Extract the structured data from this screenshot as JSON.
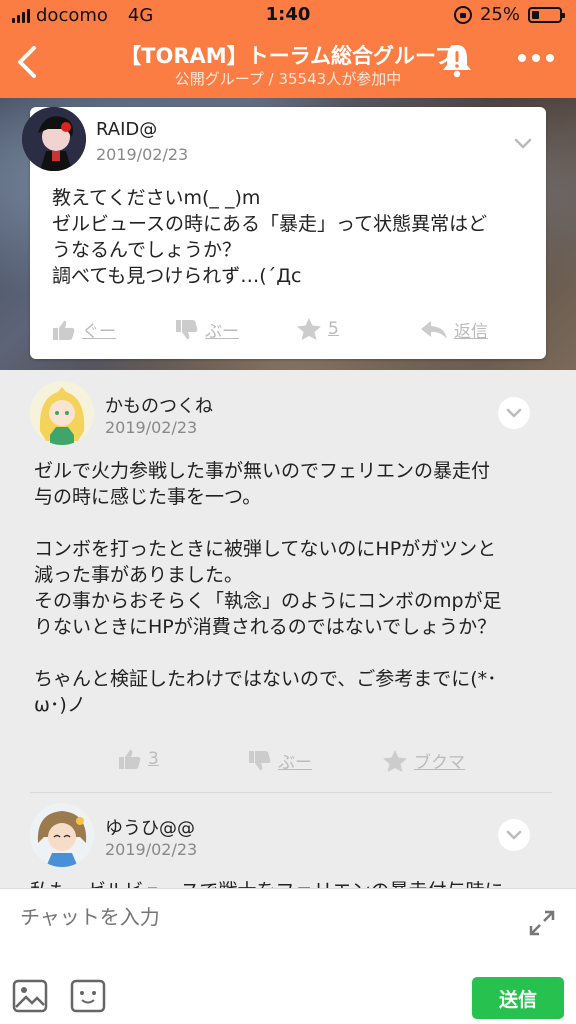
{
  "status": {
    "carrier": "docomo",
    "network": "4G",
    "time": "1:40",
    "battery": "25%",
    "battery_level": 0.25
  },
  "header": {
    "title": "【TORAM】トーラム総合グループ",
    "subtitle": "公開グループ / 35543人が参加中"
  },
  "post": {
    "username": "RAID@",
    "date": "2019/02/23",
    "lines": [
      "教えてくださいm(_ _)m",
      "ゼルビュースの時にある「暴走」って状態異常はど",
      "うなるんでしょうか？",
      "調べても見つけられず…(´Дc"
    ],
    "actions": {
      "good": "ぐー",
      "bad": "ぶー",
      "star": "5",
      "reply": "返信"
    }
  },
  "comments": [
    {
      "username": "かものつくね",
      "date": "2019/02/23",
      "lines": [
        "ゼルで火力参戦した事が無いのでフェリエンの暴走付",
        "与の時に感じた事を一つ。",
        "",
        "コンボを打ったときに被弾してないのにHPがガツンと",
        "減った事がありました。",
        "その事からおそらく「執念」のようにコンボのmpが足",
        "りないときにHPが消費されるのではないでしょうか？",
        "",
        "ちゃんと検証したわけではないので、ご参考までに(*･",
        "ω･)ノ"
      ],
      "actions": {
        "good": "3",
        "bad": "ぶー",
        "bookmark": "ブクマ"
      }
    },
    {
      "username": "ゆうひ@@",
      "date": "2019/02/23",
      "partial": "私も、ゼルビュースで戦士をフェリエンの暴走付与時に"
    }
  ],
  "input": {
    "placeholder": "チャットを入力",
    "send_label": "送信"
  },
  "colors": {
    "header": "#fb7d43",
    "send": "#27c14f"
  }
}
